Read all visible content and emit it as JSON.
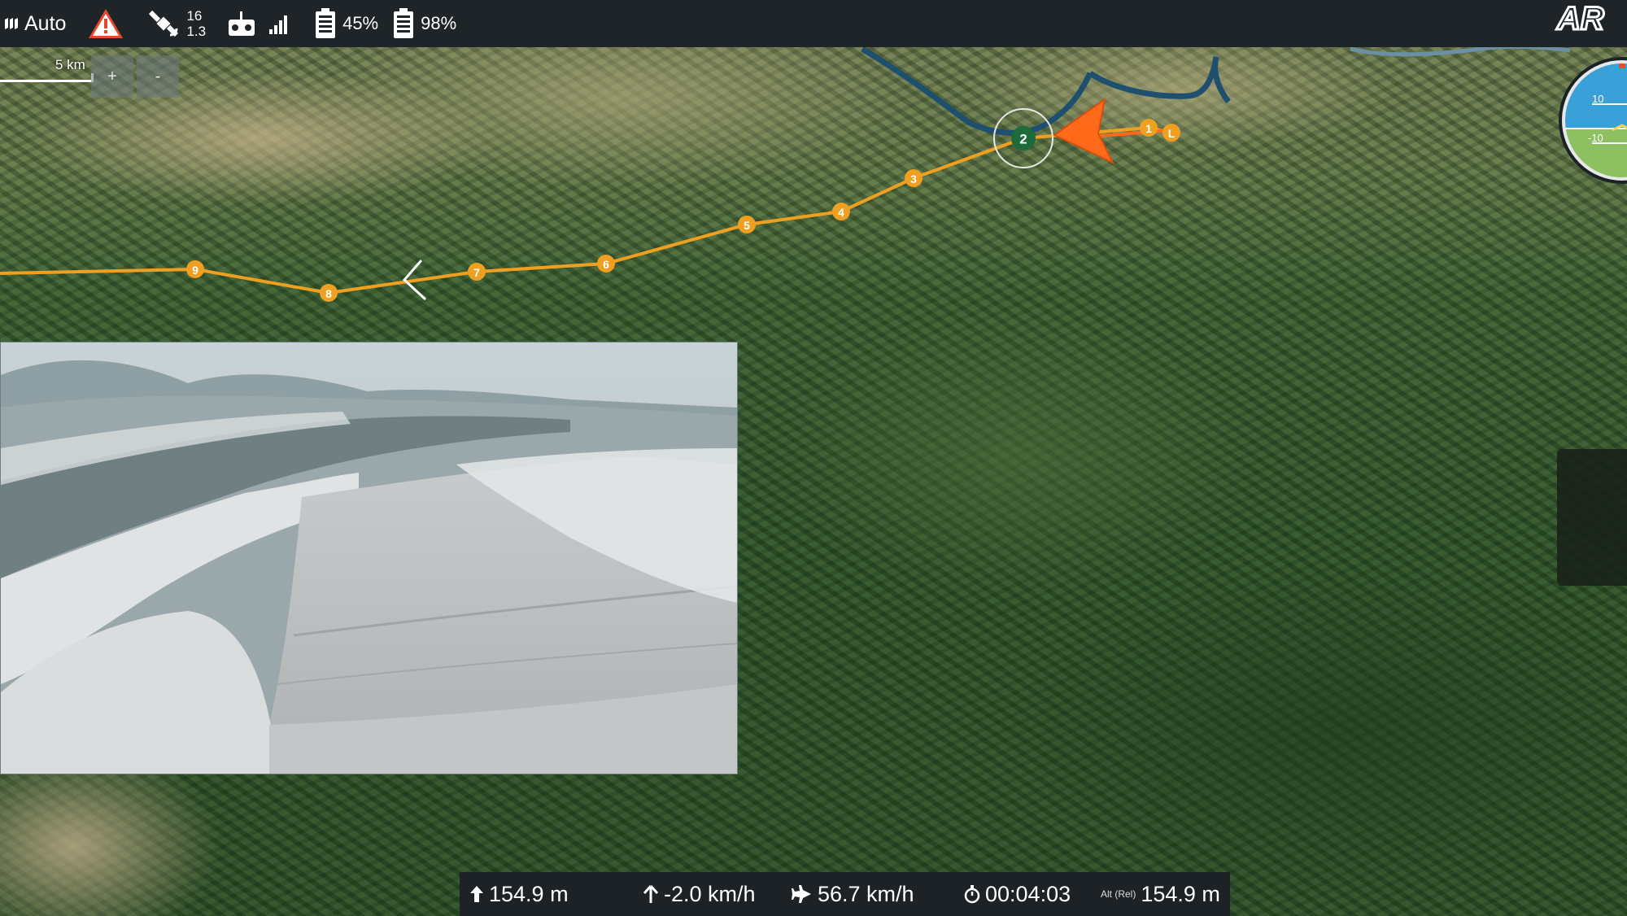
{
  "status_bar": {
    "flight_mode": "Auto",
    "warning_icon": "warning-triangle-icon",
    "satellite_count": "16",
    "hdop": "1.3",
    "battery_1_percent": "45%",
    "battery_2_percent": "98%",
    "logo_text": "AR"
  },
  "map": {
    "scale_label": "5 km",
    "zoom_in_label": "+",
    "zoom_out_label": "-",
    "route_color": "#f0a020",
    "active_waypoint_color": "#1e6a3a",
    "waypoints": [
      {
        "label": "L"
      },
      {
        "label": "1"
      },
      {
        "label": "2",
        "active": true
      },
      {
        "label": "3"
      },
      {
        "label": "4"
      },
      {
        "label": "5"
      },
      {
        "label": "6"
      },
      {
        "label": "7"
      },
      {
        "label": "8"
      },
      {
        "label": "9"
      }
    ],
    "vehicle_icon": "aircraft-arrow-icon",
    "vehicle_color": "#ff6a1a"
  },
  "attitude": {
    "pitch_up_label": "10",
    "pitch_down_label": "-10",
    "sky_color": "#3aa0d8",
    "ground_color": "#8cc060"
  },
  "telemetry": {
    "altitude_label": "154.9 m",
    "vertical_speed_label": "-2.0 km/h",
    "ground_speed_label": "56.7 km/h",
    "flight_time_label": "00:04:03",
    "alt_rel_caption": "Alt (Rel)",
    "alt_rel_label": "154.9 m"
  }
}
